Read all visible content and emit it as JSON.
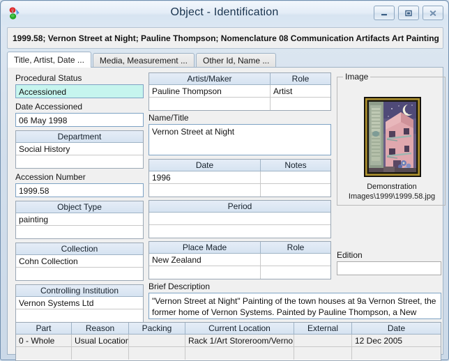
{
  "window": {
    "title": "Object - Identification",
    "app_icon": "vernon-systems-icon",
    "buttons": {
      "minimize": "minimize-button",
      "maximize": "maximize-button",
      "close": "close-button"
    }
  },
  "banner": {
    "text": "1999.58; Vernon Street at Night; Pauline Thompson; Nomenclature 08 Communication Artifacts Art Painting"
  },
  "tabs": [
    {
      "label": "Title, Artist, Date ...",
      "active": true
    },
    {
      "label": "Media, Measurement ...",
      "active": false
    },
    {
      "label": "Other Id, Name ...",
      "active": false
    }
  ],
  "left_column": {
    "procedural_status": {
      "label": "Procedural Status",
      "value": "Accessioned",
      "highlight_color": "#c6f5ee"
    },
    "date_accessioned": {
      "label": "Date Accessioned",
      "value": "06 May 1998"
    },
    "department": {
      "header": "Department",
      "rows": [
        "Social History",
        ""
      ]
    },
    "accession_number": {
      "label": "Accession Number",
      "value": "1999.58"
    },
    "object_type": {
      "header": "Object Type",
      "rows": [
        "painting",
        ""
      ]
    },
    "collection": {
      "header": "Collection",
      "rows": [
        "Cohn Collection",
        ""
      ]
    },
    "controlling_institution": {
      "header": "Controlling Institution",
      "rows": [
        "Vernon Systems Ltd",
        ""
      ]
    }
  },
  "middle_column": {
    "artist_maker": {
      "headers": [
        "Artist/Maker",
        "Role"
      ],
      "rows": [
        [
          "Pauline Thompson",
          "Artist"
        ],
        [
          "",
          ""
        ]
      ]
    },
    "name_title": {
      "label": "Name/Title",
      "value": "Vernon Street at Night"
    },
    "date_notes": {
      "headers": [
        "Date",
        "Notes"
      ],
      "rows": [
        [
          "1996",
          ""
        ],
        [
          "",
          ""
        ]
      ]
    },
    "period": {
      "header": "Period",
      "rows": [
        "",
        ""
      ]
    },
    "place_made": {
      "headers": [
        "Place Made",
        "Role"
      ],
      "rows": [
        [
          "New Zealand",
          ""
        ],
        [
          "",
          ""
        ]
      ]
    },
    "brief_description": {
      "label": "Brief Description",
      "line1": "\"Vernon Street at Night\" Painting of the town houses at 9a Vernon Street, the",
      "line2": "former home of Vernon Systems. Painted by Pauline Thompson, a New Zealand"
    }
  },
  "right_column": {
    "image_group": {
      "title": "Image",
      "caption_line1": "Demonstration",
      "caption_line2": "Images\\1999\\1999.58.jpg",
      "thumbnail_alt": "painting-thumbnail"
    },
    "edition": {
      "label": "Edition",
      "value": ""
    }
  },
  "bottom_table": {
    "headers": [
      "Part",
      "Reason",
      "Packing",
      "Current Location",
      "External",
      "Date"
    ],
    "rows": [
      [
        "0 - Whole",
        "Usual Location",
        "",
        "Rack 1/Art Storeroom/Verno...",
        "",
        "12 Dec 2005"
      ],
      [
        "",
        "",
        "",
        "",
        "",
        ""
      ]
    ]
  }
}
